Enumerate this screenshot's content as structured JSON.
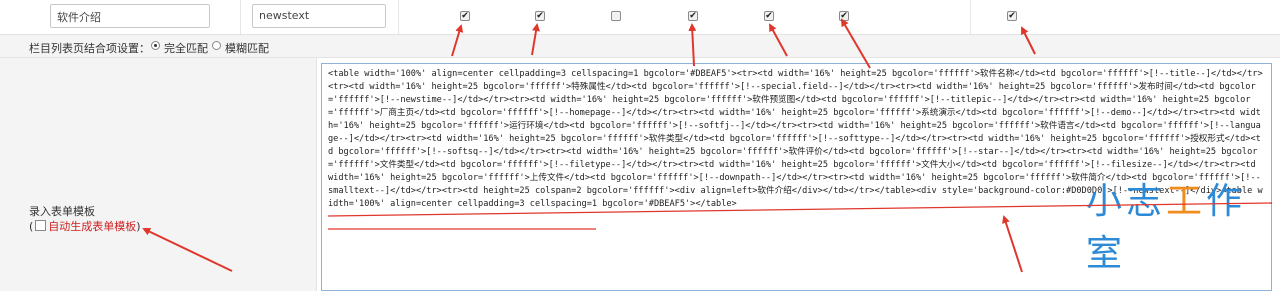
{
  "fields": {
    "software_intro": "软件介绍",
    "newstext": "newstext"
  },
  "checkboxes": [
    true,
    true,
    false,
    true,
    true,
    true,
    true
  ],
  "match_setting": {
    "label": "栏目列表页结合项设置：",
    "exact": "完全匹配",
    "fuzzy": "模糊匹配",
    "selected": "exact"
  },
  "form_template": {
    "label": "录入表单模板",
    "open_paren": "(",
    "auto_label": "自动生成表单模板",
    "close_paren": ")",
    "auto_checked": false,
    "code": "<table width='100%' align=center cellpadding=3 cellspacing=1 bgcolor='#DBEAF5'><tr><td width='16%' height=25 bgcolor='ffffff'>软件名称</td><td bgcolor='ffffff'>[!--title--]</td></tr><tr><td width='16%' height=25 bgcolor='ffffff'>特殊属性</td><td bgcolor='ffffff'>[!--special.field--]</td></tr><tr><td width='16%' height=25 bgcolor='ffffff'>发布时间</td><td bgcolor='ffffff'>[!--newstime--]</td></tr><tr><td width='16%' height=25 bgcolor='ffffff'>软件预览图</td><td bgcolor='ffffff'>[!--titlepic--]</td></tr><tr><td width='16%' height=25 bgcolor='ffffff'>厂商主页</td><td bgcolor='ffffff'>[!--homepage--]</td></tr><tr><td width='16%' height=25 bgcolor='ffffff'>系统演示</td><td bgcolor='ffffff'>[!--demo--]</td></tr><tr><td width='16%' height=25 bgcolor='ffffff'>运行环境</td><td bgcolor='ffffff'>[!--softfj--]</td></tr><tr><td width='16%' height=25 bgcolor='ffffff'>软件语言</td><td bgcolor='ffffff'>[!--language--]</td></tr><tr><td width='16%' height=25 bgcolor='ffffff'>软件类型</td><td bgcolor='ffffff'>[!--softtype--]</td></tr><tr><td width='16%' height=25 bgcolor='ffffff'>授权形式</td><td bgcolor='ffffff'>[!--softsq--]</td></tr><tr><td width='16%' height=25 bgcolor='ffffff'>软件评价</td><td bgcolor='ffffff'>[!--star--]</td></tr><tr><td width='16%' height=25 bgcolor='ffffff'>文件类型</td><td bgcolor='ffffff'>[!--filetype--]</td></tr><tr><td width='16%' height=25 bgcolor='ffffff'>文件大小</td><td bgcolor='ffffff'>[!--filesize--]</td></tr><tr><td width='16%' height=25 bgcolor='ffffff'>上传文件</td><td bgcolor='ffffff'>[!--downpath--]</td></tr><tr><td width='16%' height=25 bgcolor='ffffff'>软件简介</td><td bgcolor='ffffff'>[!--smalltext--]</td></tr><tr><td height=25 colspan=2 bgcolor='ffffff'><div align=left>软件介绍</div></td></tr></table><div style='background-color:#D0D0D0'>[!--newstext--]</div><table width='100%' align=center cellpadding=3 cellspacing=1 bgcolor='#DBEAF5'></table>"
  },
  "watermark": [
    "小",
    "志",
    "工",
    "作",
    "室"
  ],
  "colors": {
    "arrow": "#e0372c",
    "editor_border": "#8db3d9",
    "auto_label": "#cc2222"
  }
}
